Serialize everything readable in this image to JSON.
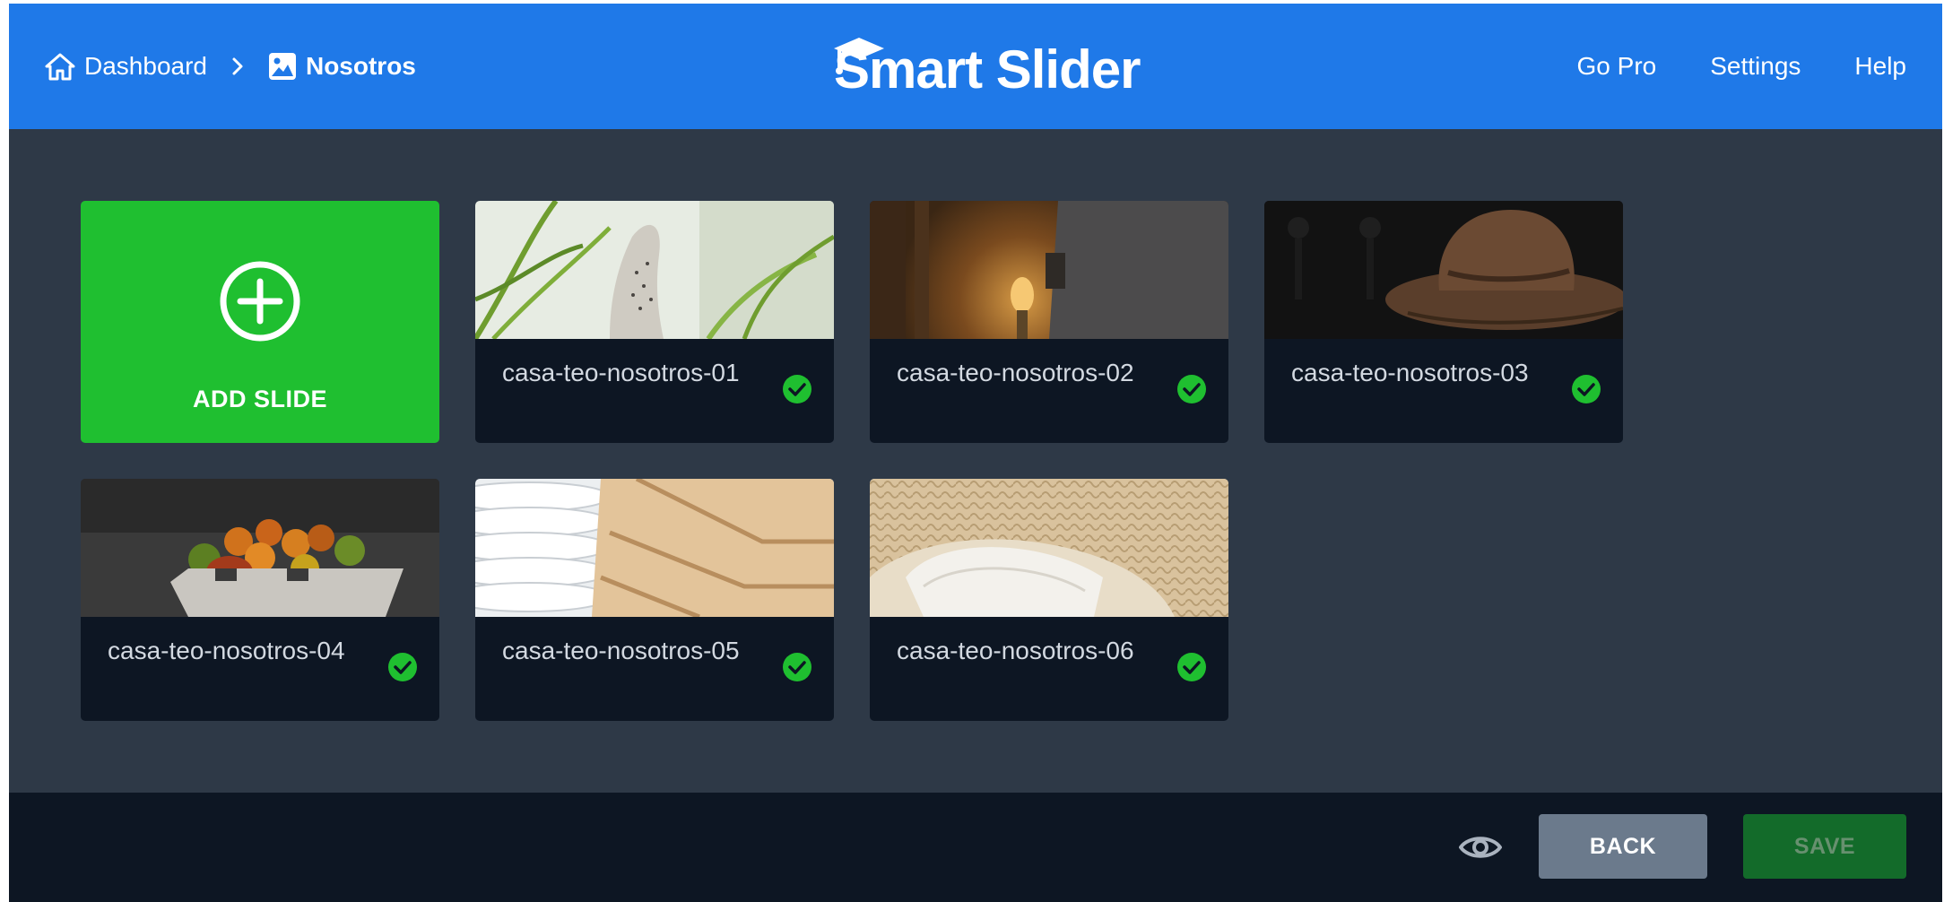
{
  "header": {
    "breadcrumbs": [
      {
        "label": "Dashboard",
        "icon": "home-icon"
      },
      {
        "label": "Nosotros",
        "icon": "image-icon"
      }
    ],
    "separator_icon": "chevron-right-icon",
    "brand": "Smart Slider",
    "nav": [
      {
        "label": "Go Pro"
      },
      {
        "label": "Settings"
      },
      {
        "label": "Help"
      }
    ]
  },
  "add_slide": {
    "label": "ADD SLIDE",
    "icon": "plus-circle-icon"
  },
  "slides": [
    {
      "title": "casa-teo-nosotros-01",
      "status": "published",
      "status_icon": "check-circle-icon"
    },
    {
      "title": "casa-teo-nosotros-02",
      "status": "published",
      "status_icon": "check-circle-icon"
    },
    {
      "title": "casa-teo-nosotros-03",
      "status": "published",
      "status_icon": "check-circle-icon"
    },
    {
      "title": "casa-teo-nosotros-04",
      "status": "published",
      "status_icon": "check-circle-icon"
    },
    {
      "title": "casa-teo-nosotros-05",
      "status": "published",
      "status_icon": "check-circle-icon"
    },
    {
      "title": "casa-teo-nosotros-06",
      "status": "published",
      "status_icon": "check-circle-icon"
    }
  ],
  "footer": {
    "preview_icon": "eye-icon",
    "back_label": "BACK",
    "save_label": "SAVE"
  },
  "colors": {
    "header_bg": "#1f79e8",
    "workspace_bg": "#2e3947",
    "card_bg": "#0d1623",
    "add_slide_bg": "#1fbf30",
    "status_green": "#1fbf30",
    "back_button": "#6b7a8c",
    "save_button": "#136b2a"
  }
}
